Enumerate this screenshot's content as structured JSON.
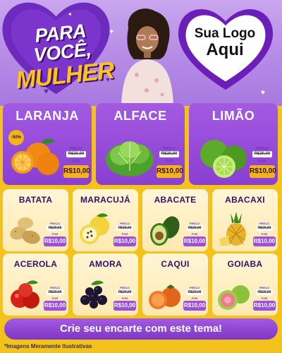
{
  "header": {
    "title_line1": "PARA VOCÊ,",
    "title_line2": "MULHER",
    "logo_line1": "Sua Logo",
    "logo_line2": "Aqui"
  },
  "featured": [
    {
      "name": "LARANJA",
      "badge": "-50%",
      "price_label": "PREÇO",
      "old_price": "R$20,00",
      "por_label": "POR",
      "new_price": "R$10,00"
    },
    {
      "name": "ALFACE",
      "price_label": "PREÇO",
      "old_price": "R$20,00",
      "por_label": "POR",
      "new_price": "R$10,00"
    },
    {
      "name": "LIMÃO",
      "price_label": "PREÇO",
      "old_price": "R$20,00",
      "por_label": "POR",
      "new_price": "R$10,00"
    }
  ],
  "products": [
    {
      "name": "BATATA",
      "price_label": "PREÇO",
      "old_price": "R$20,00",
      "por_label": "POR",
      "new_price": "R$10,00"
    },
    {
      "name": "MARACUJÁ",
      "price_label": "PREÇO",
      "old_price": "R$20,00",
      "por_label": "POR",
      "new_price": "R$10,00"
    },
    {
      "name": "ABACATE",
      "price_label": "PREÇO",
      "old_price": "R$20,00",
      "por_label": "POR",
      "new_price": "R$10,00"
    },
    {
      "name": "ABACAXI",
      "price_label": "PREÇO",
      "old_price": "R$20,00",
      "por_label": "POR",
      "new_price": "R$10,00"
    },
    {
      "name": "ACEROLA",
      "price_label": "PREÇO",
      "old_price": "R$20,00",
      "por_label": "POR",
      "new_price": "R$10,00"
    },
    {
      "name": "AMORA",
      "price_label": "PREÇO",
      "old_price": "R$20,00",
      "por_label": "POR",
      "new_price": "R$10,00"
    },
    {
      "name": "CAQUI",
      "price_label": "PREÇO",
      "old_price": "R$20,00",
      "por_label": "POR",
      "new_price": "R$10,00"
    },
    {
      "name": "GOIABA",
      "price_label": "PREÇO",
      "old_price": "R$20,00",
      "por_label": "POR",
      "new_price": "R$10,00"
    }
  ],
  "footer": {
    "cta": "Crie seu encarte com este tema!",
    "disclaimer": "*Imagens Meramente Ilustrativas"
  },
  "colors": {
    "purple": "#8a3fd0",
    "dark_purple": "#3a0e66",
    "yellow": "#f4c21d",
    "cream": "#fff2cc",
    "price_yellow": "#f6b21a"
  },
  "icons": [
    "heart-icon",
    "woman-photo",
    "sparkle-icon"
  ]
}
